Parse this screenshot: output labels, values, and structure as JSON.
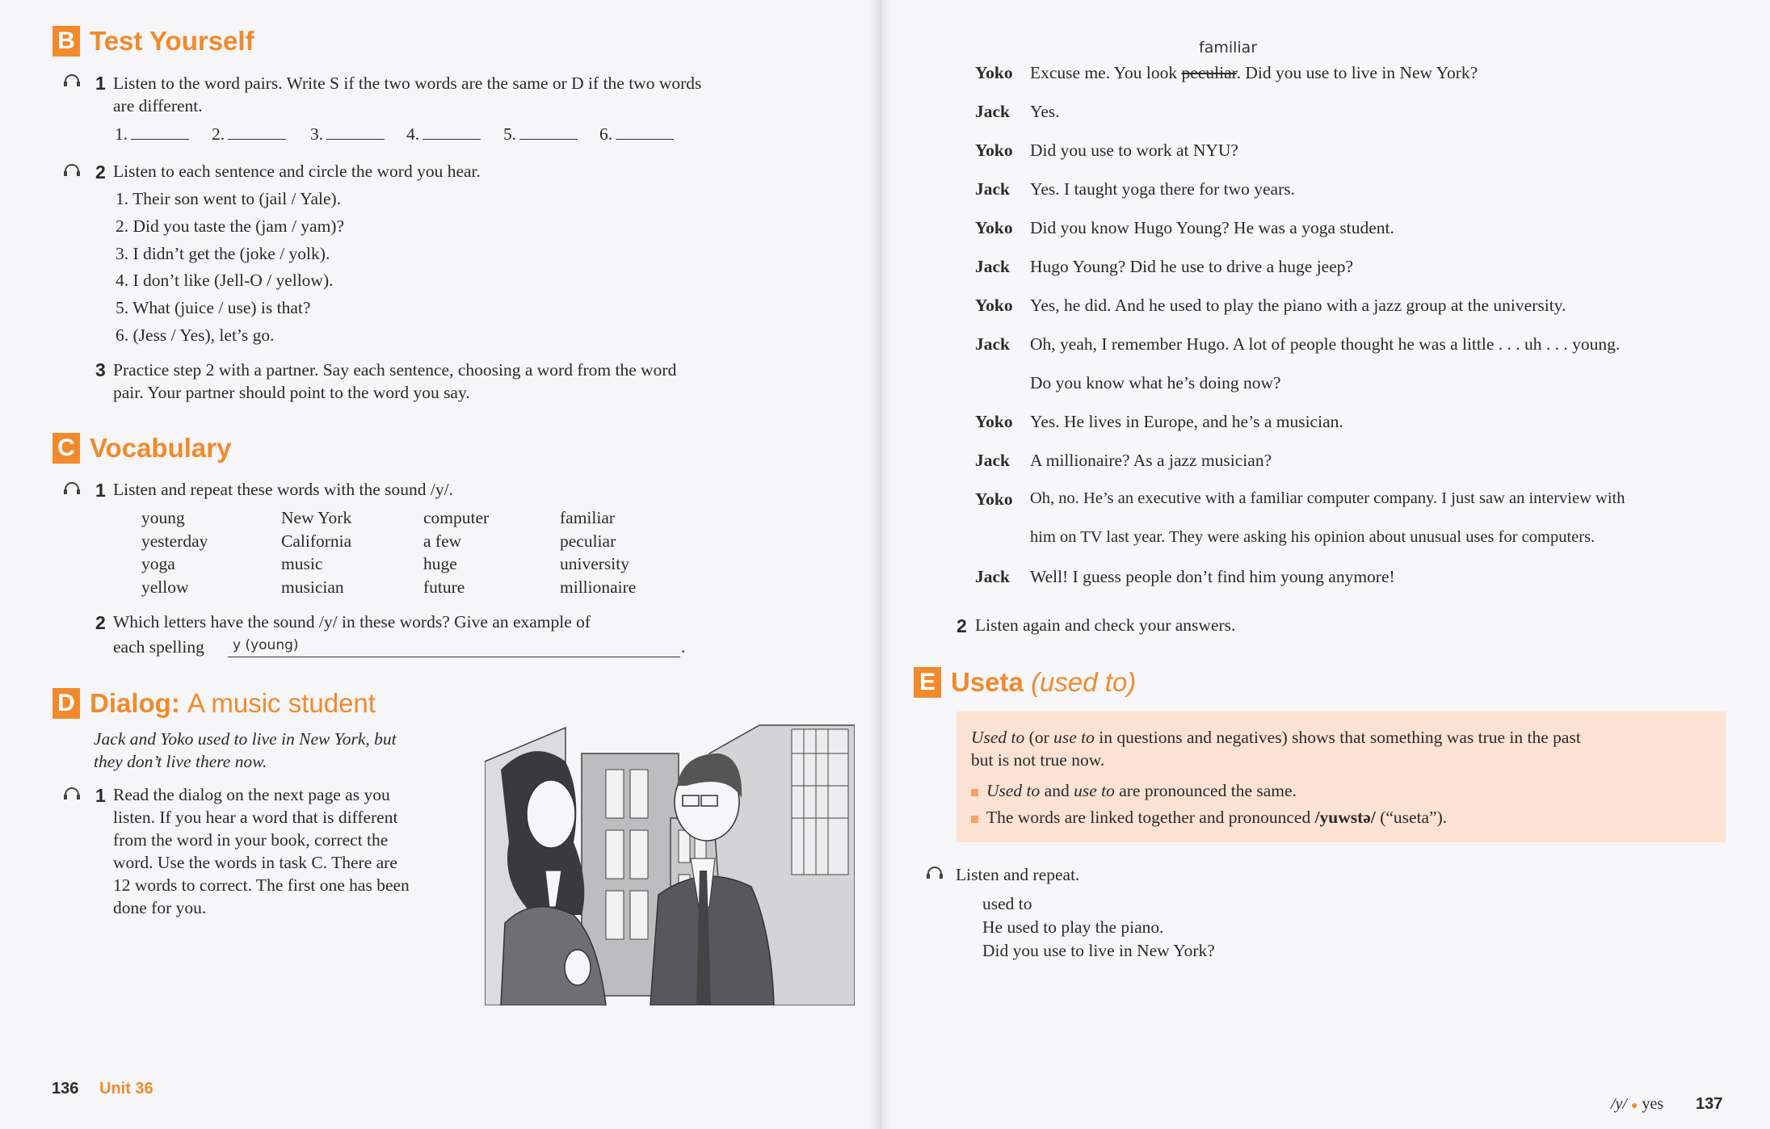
{
  "left": {
    "sectionB": {
      "letter": "B",
      "title": "Test Yourself",
      "task1_num": "1",
      "task1_text_a": "Listen to the word pairs. Write S if the two words are the same or D if the two words",
      "task1_text_b": "are different.",
      "blanks": [
        "1.",
        "2.",
        "3.",
        "4.",
        "5.",
        "6."
      ],
      "task2_num": "2",
      "task2_text": "Listen to each sentence and circle the word you hear.",
      "sentences": [
        "1. Their son went to (jail / Yale).",
        "2. Did you taste the (jam / yam)?",
        "3. I didn’t get the (joke / yolk).",
        "4. I don’t like (Jell-O / yellow).",
        "5. What (juice / use) is that?",
        "6. (Jess / Yes), let’s go."
      ],
      "task3_num": "3",
      "task3_text_a": "Practice step 2 with a partner. Say each sentence, choosing a word from the word",
      "task3_text_b": "pair. Your partner should point to the word you say."
    },
    "sectionC": {
      "letter": "C",
      "title": "Vocabulary",
      "task1_num": "1",
      "task1_text": "Listen and repeat these words with the sound /y/.",
      "col1": [
        "young",
        "yesterday",
        "yoga",
        "yellow"
      ],
      "col2": [
        "New York",
        "California",
        "music",
        "musician"
      ],
      "col3": [
        "computer",
        "a few",
        "huge",
        "future"
      ],
      "col4": [
        "familiar",
        "peculiar",
        "university",
        "millionaire"
      ],
      "task2_num": "2",
      "task2_text_a": "Which letters have the sound /y/ in these words? Give an example of",
      "task2_text_b": "each spelling",
      "task2_handwritten": "y (young)"
    },
    "sectionD": {
      "letter": "D",
      "title_bold": "Dialog:",
      "title_rest": "A music student",
      "intro_a": "Jack and Yoko used to live in New York, but",
      "intro_b": "they don’t live there now.",
      "task1_num": "1",
      "task1_lines": [
        "Read the dialog on the next page as you",
        "listen. If you hear a word that is different",
        "from the word in your book, correct the",
        "word. Use the words in task C. There are",
        "12 words to correct. The first one has been",
        "done for you."
      ]
    },
    "footer": {
      "page": "136",
      "unit": "Unit 36"
    }
  },
  "right": {
    "handwritten_correction": "familiar",
    "dialog": [
      {
        "speaker": "Yoko",
        "pre": "Excuse me. You look ",
        "struck": "peculiar",
        "post": ". Did you use to live in New York?"
      },
      {
        "speaker": "Jack",
        "text": "Yes."
      },
      {
        "speaker": "Yoko",
        "text": "Did you use to work at NYU?"
      },
      {
        "speaker": "Jack",
        "text": "Yes. I taught yoga there for two years."
      },
      {
        "speaker": "Yoko",
        "text": "Did you know Hugo Young? He was a yoga student."
      },
      {
        "speaker": "Jack",
        "text": "Hugo Young? Did he use to drive a huge jeep?"
      },
      {
        "speaker": "Yoko",
        "text": "Yes, he did. And he used to play the piano with a jazz group at the university."
      },
      {
        "speaker": "Jack",
        "text": "Oh, yeah, I remember Hugo. A lot of people thought he was a little . . . uh . . . young.",
        "cont": "Do you know what he’s doing now?"
      },
      {
        "speaker": "Yoko",
        "text": "Yes. He lives in Europe, and he’s a musician."
      },
      {
        "speaker": "Jack",
        "text": "A millionaire? As a jazz musician?"
      },
      {
        "speaker": "Yoko",
        "text": "Oh, no. He’s an executive with a familiar computer company. I just saw an interview with",
        "cont": "him on TV last year. They were asking his opinion about unusual uses for computers."
      },
      {
        "speaker": "Jack",
        "text": "Well! I guess people don’t find him young anymore!"
      }
    ],
    "task2_num": "2",
    "task2_text": "Listen again and check your answers.",
    "sectionE": {
      "letter": "E",
      "title_bold": "Useta",
      "title_ital": "(used to)",
      "callout_line1_a": "Used to",
      "callout_line1_b": " (or ",
      "callout_line1_c": "use to",
      "callout_line1_d": " in questions and negatives) shows that something was true in the past",
      "callout_line2": "but is not true now.",
      "bullet1_a": "Used to",
      "bullet1_b": " and ",
      "bullet1_c": "use to",
      "bullet1_d": " are pronounced the same.",
      "bullet2_a": "The words are linked together and pronounced ",
      "bullet2_b": "/yuwstə/",
      "bullet2_c": " (“useta”).",
      "listen": "Listen and repeat.",
      "repeat_lines": [
        "used to",
        "He used to play the piano.",
        "Did you use to live in New York?"
      ]
    },
    "footer": {
      "label": "/y/",
      "word": "yes",
      "page": "137"
    }
  }
}
